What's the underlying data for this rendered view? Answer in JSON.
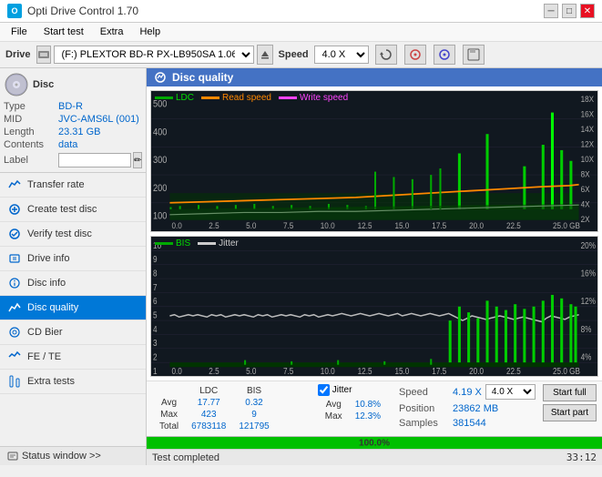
{
  "app": {
    "title": "Opti Drive Control 1.70",
    "icon_text": "O"
  },
  "menu": {
    "items": [
      "File",
      "Start test",
      "Extra",
      "Help"
    ]
  },
  "toolbar": {
    "drive_label": "Drive",
    "drive_value": "(F:) PLEXTOR BD-R  PX-LB950SA 1.06",
    "speed_label": "Speed",
    "speed_value": "4.0 X"
  },
  "disc": {
    "title": "Disc",
    "type_label": "Type",
    "type_value": "BD-R",
    "mid_label": "MID",
    "mid_value": "JVC-AMS6L (001)",
    "length_label": "Length",
    "length_value": "23.31 GB",
    "contents_label": "Contents",
    "contents_value": "data",
    "label_label": "Label",
    "label_value": ""
  },
  "nav": {
    "items": [
      {
        "id": "transfer-rate",
        "label": "Transfer rate",
        "icon": "📊"
      },
      {
        "id": "create-test-disc",
        "label": "Create test disc",
        "icon": "💿"
      },
      {
        "id": "verify-test-disc",
        "label": "Verify test disc",
        "icon": "✔"
      },
      {
        "id": "drive-info",
        "label": "Drive info",
        "icon": "ℹ"
      },
      {
        "id": "disc-info",
        "label": "Disc info",
        "icon": "📋"
      },
      {
        "id": "disc-quality",
        "label": "Disc quality",
        "icon": "📉",
        "active": true
      },
      {
        "id": "cd-bier",
        "label": "CD Bier",
        "icon": "🍺"
      },
      {
        "id": "fe-te",
        "label": "FE / TE",
        "icon": "📈"
      },
      {
        "id": "extra-tests",
        "label": "Extra tests",
        "icon": "🔬"
      }
    ],
    "status_window": "Status window >>"
  },
  "disc_quality": {
    "title": "Disc quality",
    "chart1": {
      "legends": [
        {
          "label": "LDC",
          "color": "#00aa00"
        },
        {
          "label": "Read speed",
          "color": "#ff6600"
        },
        {
          "label": "Write speed",
          "color": "#ff00ff"
        }
      ],
      "y_max": 500,
      "y_right_max": 18,
      "x_max": 25,
      "y_right_labels": [
        "18X",
        "16X",
        "14X",
        "12X",
        "10X",
        "8X",
        "6X",
        "4X",
        "2X"
      ]
    },
    "chart2": {
      "legends": [
        {
          "label": "BIS",
          "color": "#00aa00"
        },
        {
          "label": "Jitter",
          "color": "#cccccc"
        }
      ],
      "y_max": 10,
      "y_right_max": 20,
      "x_max": 25
    }
  },
  "stats": {
    "columns": [
      "LDC",
      "BIS",
      "",
      "Jitter",
      "Speed"
    ],
    "avg_label": "Avg",
    "avg_ldc": "17.77",
    "avg_bis": "0.32",
    "avg_jitter": "10.8%",
    "max_label": "Max",
    "max_ldc": "423",
    "max_bis": "9",
    "max_jitter": "12.3%",
    "total_label": "Total",
    "total_ldc": "6783118",
    "total_bis": "121795",
    "speed_display": "4.19 X",
    "speed_dropdown": "4.0 X",
    "position_label": "Position",
    "position_value": "23862 MB",
    "samples_label": "Samples",
    "samples_value": "381544",
    "jitter_checked": true,
    "jitter_label": "Jitter",
    "start_full": "Start full",
    "start_part": "Start part"
  },
  "footer": {
    "status": "Test completed",
    "progress": "100.0%",
    "time": "33:12"
  }
}
